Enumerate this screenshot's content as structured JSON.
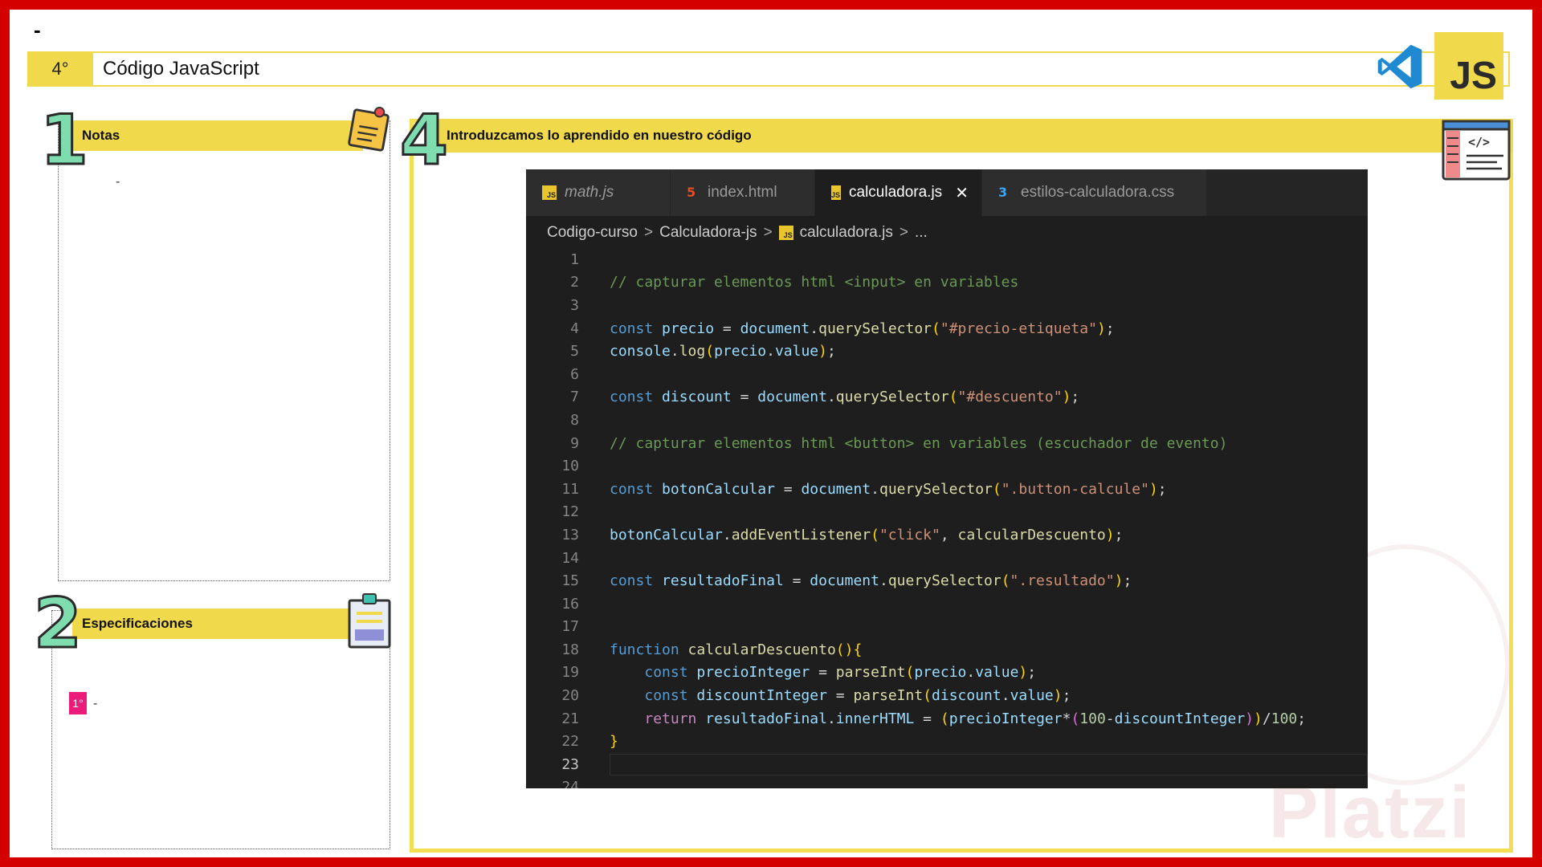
{
  "header": {
    "top_dash": "-",
    "number": "4°",
    "title": "Código JavaScript",
    "js_badge": "JS"
  },
  "sections": {
    "notes": {
      "number": "1",
      "title": "Notas",
      "body": "-"
    },
    "specs": {
      "number": "2",
      "title": "Especificaciones",
      "chip": "1°",
      "body": "-"
    },
    "code": {
      "number": "4",
      "title": "Introduzcamos lo aprendido en nuestro código"
    }
  },
  "editor": {
    "tabs": [
      {
        "label": "math.js",
        "icon": "js-icon"
      },
      {
        "label": "index.html",
        "icon": "html-icon"
      },
      {
        "label": "calculadora.js",
        "icon": "js-icon",
        "active": true
      },
      {
        "label": "estilos-calculadora.css",
        "icon": "css-icon"
      }
    ],
    "breadcrumb": [
      "Codigo-curso",
      "Calculadora-js",
      "calculadora.js",
      "..."
    ],
    "js_icon_text": "JS",
    "current_line": 23,
    "lines": [
      "",
      "// capturar elementos html <input> en variables",
      "",
      "const precio = document.querySelector(\"#precio-etiqueta\");",
      "console.log(precio.value);",
      "",
      "const discount = document.querySelector(\"#descuento\");",
      "",
      "// capturar elementos html <button> en variables (escuchador de evento)",
      "",
      "const botonCalcular = document.querySelector(\".button-calcule\");",
      "",
      "botonCalcular.addEventListener(\"click\", calcularDescuento);",
      "",
      "const resultadoFinal = document.querySelector(\".resultado\");",
      "",
      "",
      "function calcularDescuento(){",
      "    const precioInteger = parseInt(precio.value);",
      "    const discountInteger = parseInt(discount.value);",
      "    return resultadoFinal.innerHTML = (precioInteger*(100-discountInteger))/100;",
      "}",
      "",
      ""
    ]
  },
  "watermark": "Platzi",
  "colors": {
    "frame": "#d40000",
    "accent_yellow": "#f0d94a",
    "number_green": "#7fdcae",
    "chip_pink": "#ec1a79",
    "editor_bg": "#1e1e1e"
  }
}
